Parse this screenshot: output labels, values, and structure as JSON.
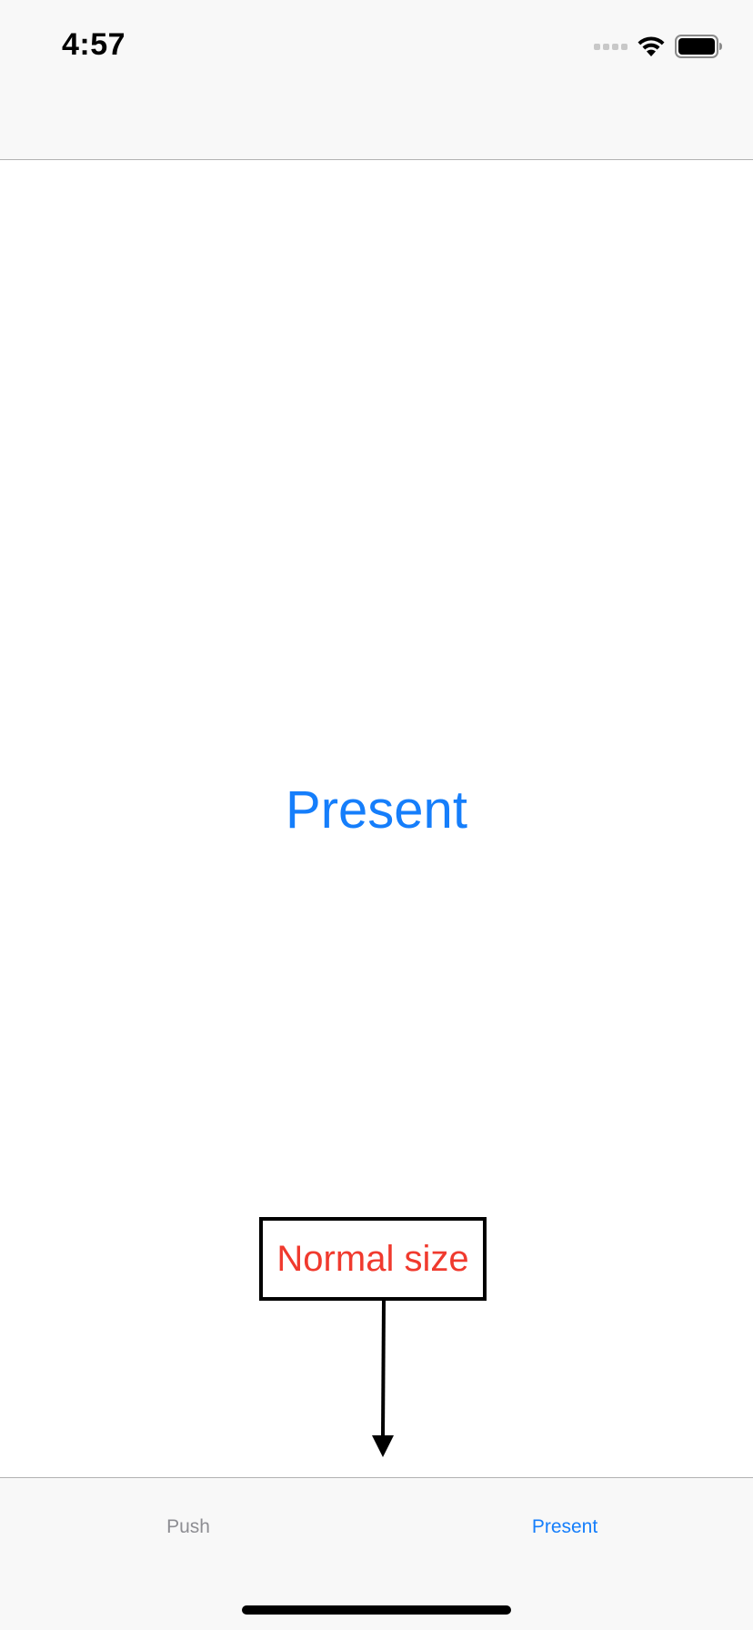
{
  "status_bar": {
    "time": "4:57"
  },
  "main": {
    "center_button_label": "Present"
  },
  "annotation": {
    "label": "Normal size",
    "label_color": "#f03a2e"
  },
  "tab_bar": {
    "tabs": [
      {
        "label": "Push",
        "selected": false
      },
      {
        "label": "Present",
        "selected": true
      }
    ]
  },
  "colors": {
    "accent": "#157efb",
    "tab_inactive": "#8e8e93",
    "bar_background": "#f8f8f8"
  }
}
